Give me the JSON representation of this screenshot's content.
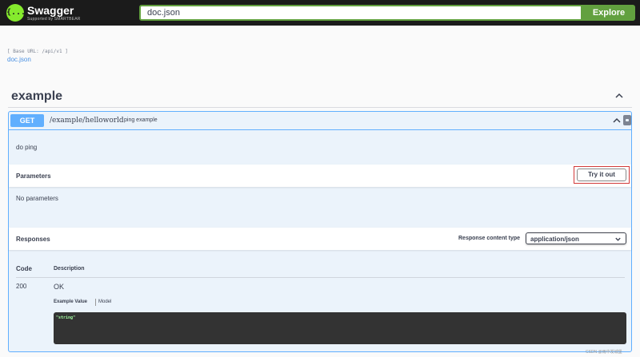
{
  "topbar": {
    "logo_glyph": "{...}",
    "brand": "Swagger",
    "brand_sub": "Supported by SMARTBEAR",
    "url_value": "doc.json",
    "explore_label": "Explore"
  },
  "info": {
    "base_url": "[ Base URL: /api/v1 ]",
    "doc_link": "doc.json"
  },
  "section": {
    "title": "example"
  },
  "operation": {
    "method": "GET",
    "path": "/example/helloworld",
    "summary": "ping example",
    "description": "do ping",
    "parameters_title": "Parameters",
    "try_label": "Try it out",
    "no_parameters": "No parameters",
    "responses_title": "Responses",
    "content_type_label": "Response content type",
    "content_type_value": "application/json",
    "table_headers": {
      "code": "Code",
      "description": "Description"
    },
    "responses": [
      {
        "code": "200",
        "description": "OK"
      }
    ],
    "example_tab": "Example Value",
    "model_tab": "Model",
    "example_body": "\"string\""
  },
  "watermark": "CSDN @雨中发城堡",
  "colors": {
    "topbar_bg": "#1b1b1b",
    "explore_green": "#62a03f",
    "get_blue": "#61affe",
    "highlight_red": "#d23a3a"
  }
}
